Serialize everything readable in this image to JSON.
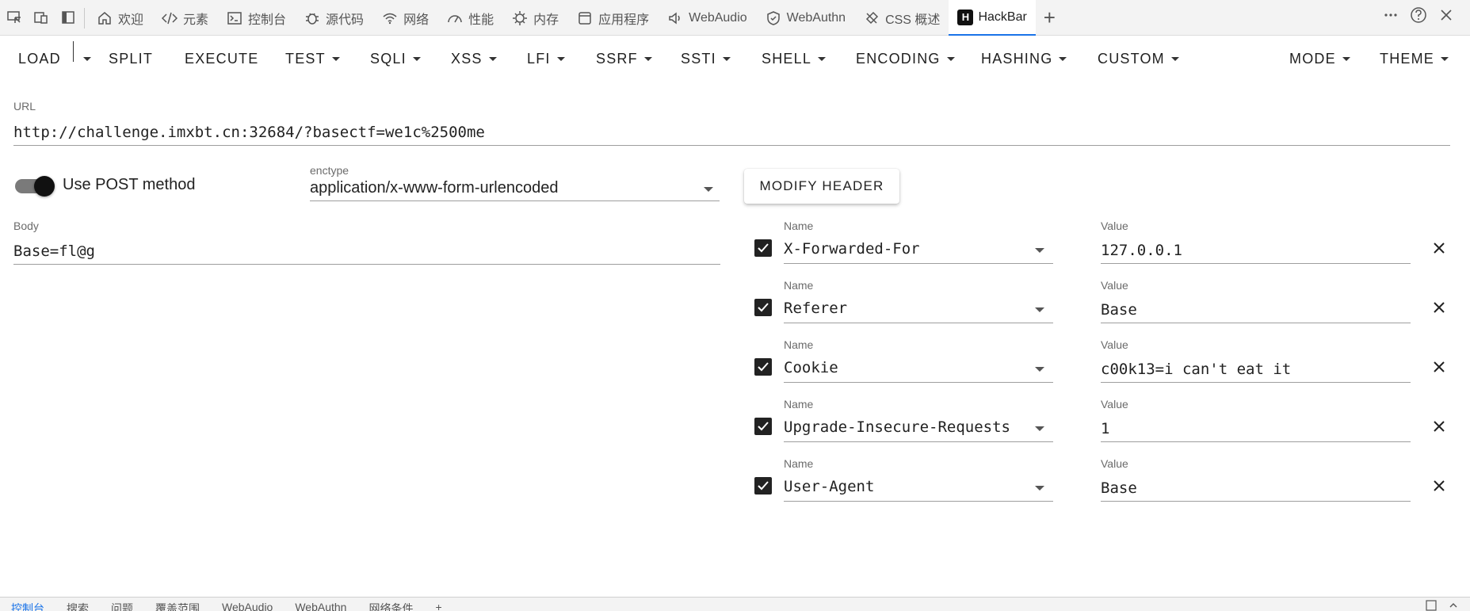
{
  "devtools": {
    "tabs": [
      {
        "label": "欢迎",
        "icon": "home-icon"
      },
      {
        "label": "元素",
        "icon": "code-icon"
      },
      {
        "label": "控制台",
        "icon": "console-icon"
      },
      {
        "label": "源代码",
        "icon": "bug-icon"
      },
      {
        "label": "网络",
        "icon": "wifi-icon"
      },
      {
        "label": "性能",
        "icon": "performance-icon"
      },
      {
        "label": "内存",
        "icon": "memory-icon"
      },
      {
        "label": "应用程序",
        "icon": "application-icon"
      },
      {
        "label": "WebAudio",
        "icon": "audio-icon"
      },
      {
        "label": "WebAuthn",
        "icon": "shield-icon"
      },
      {
        "label": "CSS 概述",
        "icon": "css-overview-icon"
      },
      {
        "label": "HackBar",
        "icon": "hackbar-logo-icon",
        "logo_letter": "H"
      }
    ]
  },
  "menu": {
    "load": "LOAD",
    "split": "SPLIT",
    "execute": "EXECUTE",
    "test": "TEST",
    "sqli": "SQLI",
    "xss": "XSS",
    "lfi": "LFI",
    "ssrf": "SSRF",
    "ssti": "SSTI",
    "shell": "SHELL",
    "encoding": "ENCODING",
    "hashing": "HASHING",
    "custom": "CUSTOM",
    "mode": "MODE",
    "theme": "THEME"
  },
  "url": {
    "label": "URL",
    "value": "http://challenge.imxbt.cn:32684/?basectf=we1c%2500me"
  },
  "post": {
    "switch_label": "Use POST method",
    "enabled": true
  },
  "enctype": {
    "label": "enctype",
    "value": "application/x-www-form-urlencoded"
  },
  "modify_header_label": "MODIFY HEADER",
  "body": {
    "label": "Body",
    "value": "Base=fl@g"
  },
  "headers": [
    {
      "name_label": "Name",
      "name": "X-Forwarded-For",
      "value_label": "Value",
      "value": "127.0.0.1",
      "checked": true
    },
    {
      "name_label": "Name",
      "name": "Referer",
      "value_label": "Value",
      "value": "Base",
      "checked": true
    },
    {
      "name_label": "Name",
      "name": "Cookie",
      "value_label": "Value",
      "value": "c00k13=i can't eat it",
      "checked": true
    },
    {
      "name_label": "Name",
      "name": "Upgrade-Insecure-Requests",
      "value_label": "Value",
      "value": "1",
      "checked": true
    },
    {
      "name_label": "Name",
      "name": "User-Agent",
      "value_label": "Value",
      "value": "Base",
      "checked": true
    }
  ],
  "drawer": {
    "tabs": [
      "控制台",
      "搜索",
      "问题",
      "覆盖范围",
      "WebAudio",
      "WebAuthn",
      "网络条件"
    ]
  },
  "colors": {
    "accent": "#1a73e8",
    "toolbar_bg": "#f3f3f3"
  }
}
